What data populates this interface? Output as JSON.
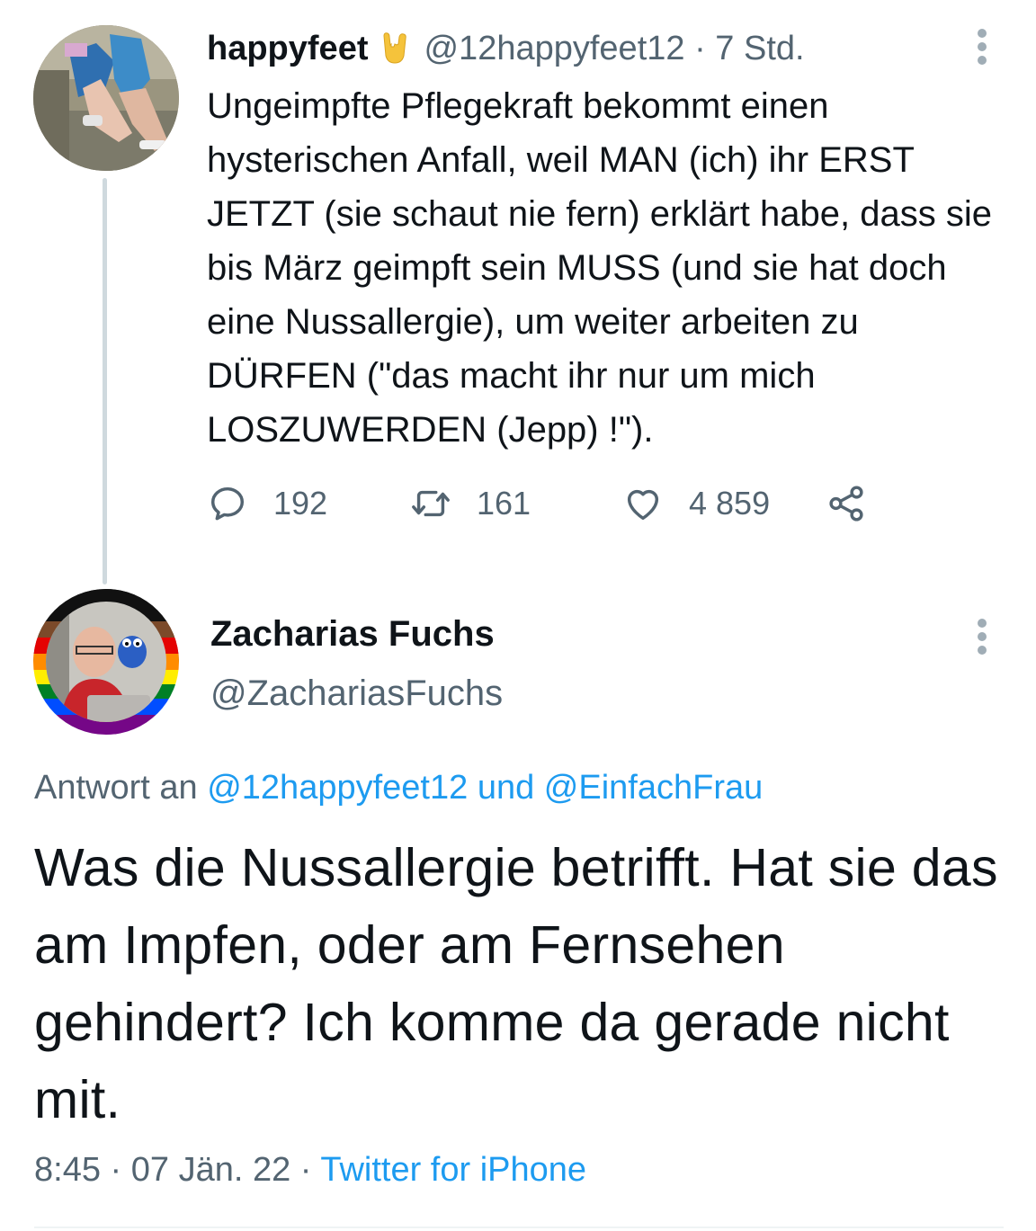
{
  "parent_tweet": {
    "display_name": "happyfeet",
    "name_emoji": "rock-on-hand-emoji",
    "handle": "@12happyfeet12",
    "separator": "·",
    "time": "7 Std.",
    "text": "Ungeimpfte Pflegekraft bekommt einen hysterischen Anfall, weil MAN (ich) ihr ERST JETZT (sie schaut nie fern) erklärt habe, dass sie bis März geimpft sein MUSS (und sie hat doch eine Nussallergie), um weiter arbeiten zu DÜRFEN (\"das macht ihr nur um mich LOSZUWERDEN (Jepp) !\").",
    "replies": "192",
    "retweets": "161",
    "likes": "4 859"
  },
  "reply_tweet": {
    "display_name": "Zacharias Fuchs",
    "handle": "@ZachariasFuchs",
    "reply_prefix": "Antwort an",
    "reply_to_1": "@12happyfeet12",
    "reply_and": "und",
    "reply_to_2": "@EinfachFrau",
    "text": "Was die Nussallergie betrifft. Hat sie das am Impfen, oder am Fernsehen gehindert? Ich komme da gerade nicht mit.",
    "time": "8:45",
    "date": "07 Jän. 22",
    "separator": "·",
    "source": "Twitter for iPhone"
  },
  "colors": {
    "text": "#0f1419",
    "secondary": "#536471",
    "link": "#1d9bf0",
    "thread_line": "#cfd9de",
    "emoji": "#f5c33b"
  },
  "icons": [
    "more-options-icon",
    "reply-icon",
    "retweet-icon",
    "like-icon",
    "share-icon"
  ]
}
